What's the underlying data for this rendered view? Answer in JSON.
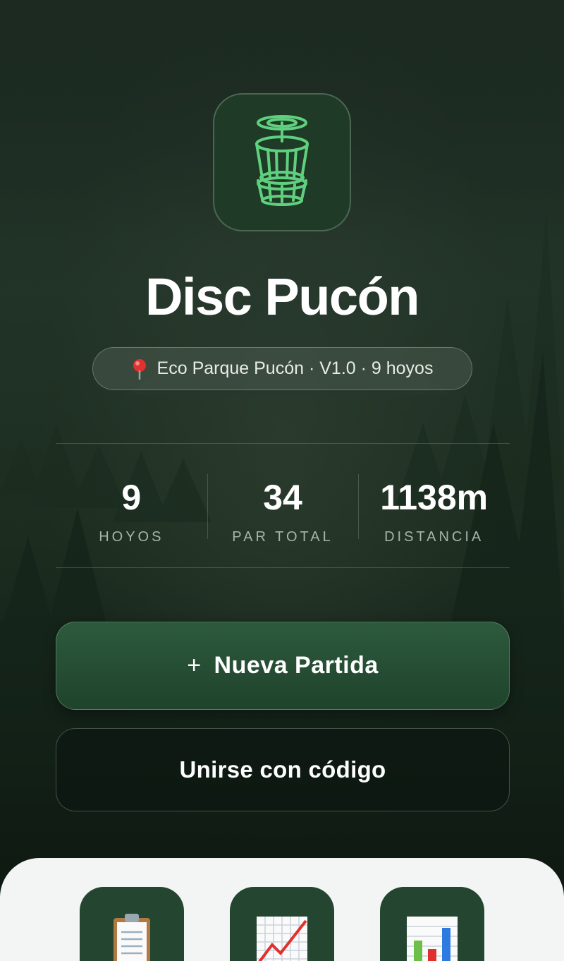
{
  "app": {
    "title": "Disc Pucón",
    "location": "Eco Parque Pucón · V1.0 · 9 hoyos"
  },
  "stats": [
    {
      "value": "9",
      "label": "HOYOS"
    },
    {
      "value": "34",
      "label": "PAR TOTAL"
    },
    {
      "value": "1138m",
      "label": "DISTANCIA"
    }
  ],
  "actions": {
    "new_game_icon": "+",
    "new_game_label": "Nueva Partida",
    "join_label": "Unirse con código"
  },
  "icons": {
    "logo": "disc-golf-basket-icon",
    "pin": "map-pin-icon",
    "tiles": [
      "clipboard-icon",
      "line-chart-icon",
      "bar-chart-icon"
    ]
  },
  "colors": {
    "accent": "#5fd07e",
    "primary_button": "#2a5238",
    "tile": "#24452f"
  }
}
